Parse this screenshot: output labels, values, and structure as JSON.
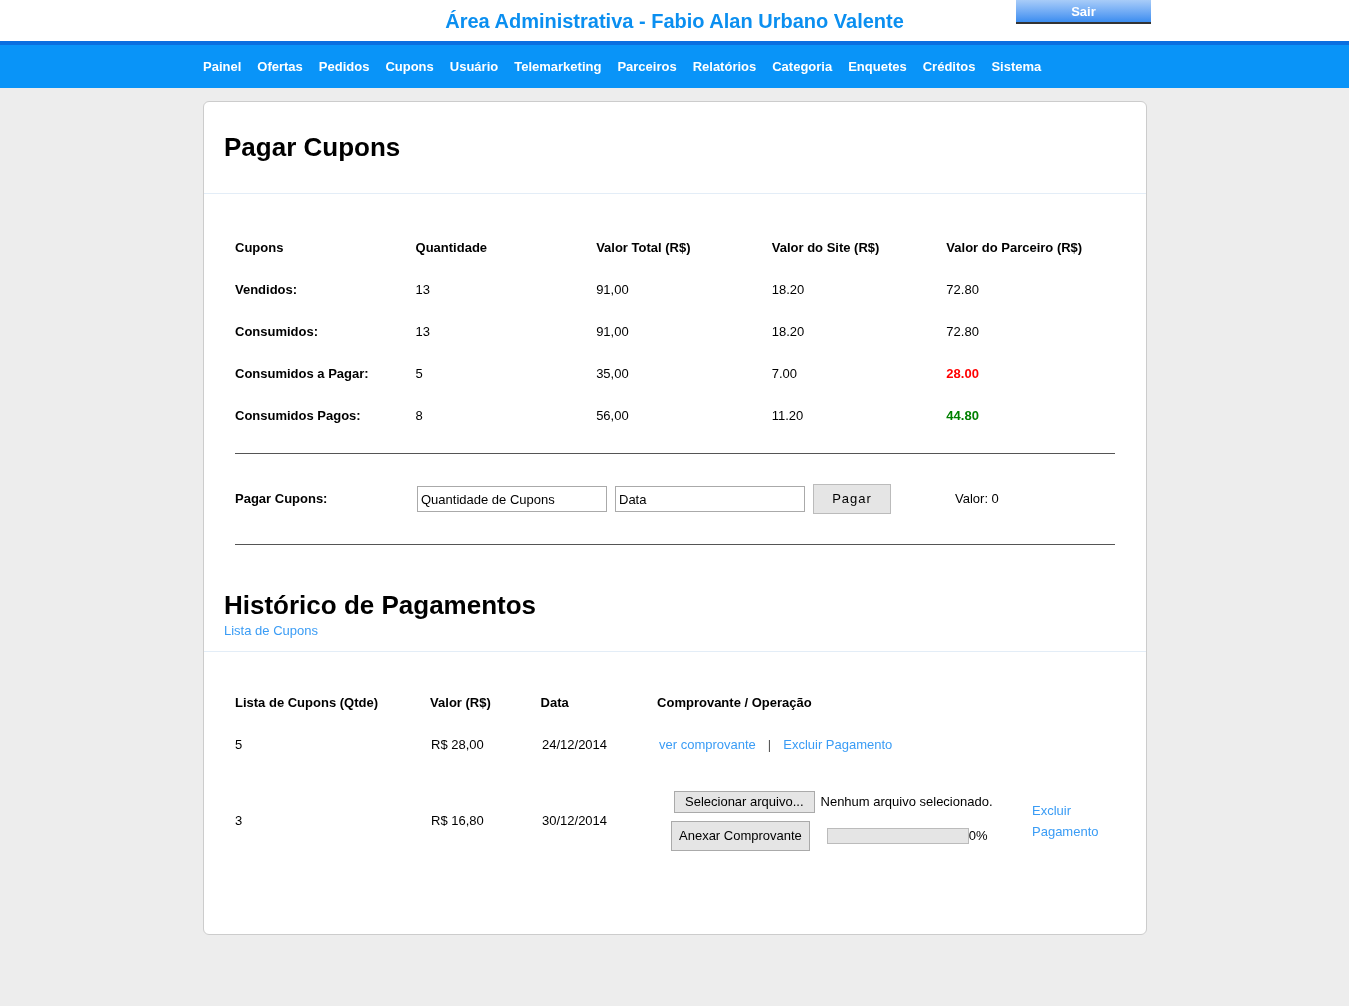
{
  "header": {
    "title": "Área Administrativa - Fabio Alan Urbano Valente",
    "logout": "Sair"
  },
  "nav": [
    "Painel",
    "Ofertas",
    "Pedidos",
    "Cupons",
    "Usuário",
    "Telemarketing",
    "Parceiros",
    "Relatórios",
    "Categoria",
    "Enquetes",
    "Créditos",
    "Sistema"
  ],
  "page_title": "Pagar Cupons",
  "summary": {
    "columns": [
      "Cupons",
      "Quantidade",
      "Valor Total (R$)",
      "Valor do Site (R$)",
      "Valor do Parceiro (R$)"
    ],
    "rows": [
      {
        "label": "Vendidos:",
        "qty": "13",
        "total": "91,00",
        "site": "18.20",
        "partner": "72.80"
      },
      {
        "label": "Consumidos:",
        "qty": "13",
        "total": "91,00",
        "site": "18.20",
        "partner": "72.80"
      },
      {
        "label": "Consumidos a Pagar:",
        "qty": "5",
        "total": "35,00",
        "site": "7.00",
        "partner": "28.00",
        "color": "#ff0000"
      },
      {
        "label": "Consumidos Pagos:",
        "qty": "8",
        "total": "56,00",
        "site": "11.20",
        "partner": "44.80",
        "color": "#008000"
      }
    ]
  },
  "pay_form": {
    "label": "Pagar Cupons:",
    "quantity_placeholder": "Quantidade de Cupons",
    "date_placeholder": "Data",
    "button": "Pagar",
    "value": "Valor: 0"
  },
  "history": {
    "title": "Histórico de Pagamentos",
    "link": "Lista de Cupons",
    "columns": [
      "Lista de Cupons (Qtde)",
      "Valor (R$)",
      "Data",
      "Comprovante / Operação"
    ],
    "rows": [
      {
        "kind": "paid",
        "qty": "5",
        "value": "R$ 28,00",
        "date": "24/12/2014",
        "view": "ver comprovante",
        "separator": "|",
        "delete": "Excluir Pagamento"
      },
      {
        "kind": "upload",
        "qty": "3",
        "value": "R$ 16,80",
        "date": "30/12/2014",
        "file_button": "Selecionar arquivo...",
        "file_status": "Nenhum arquivo selecionado.",
        "attach": "Anexar Comprovante",
        "level": 0,
        "percent": "0%",
        "delete": "Excluir Pagamento"
      }
    ]
  }
}
